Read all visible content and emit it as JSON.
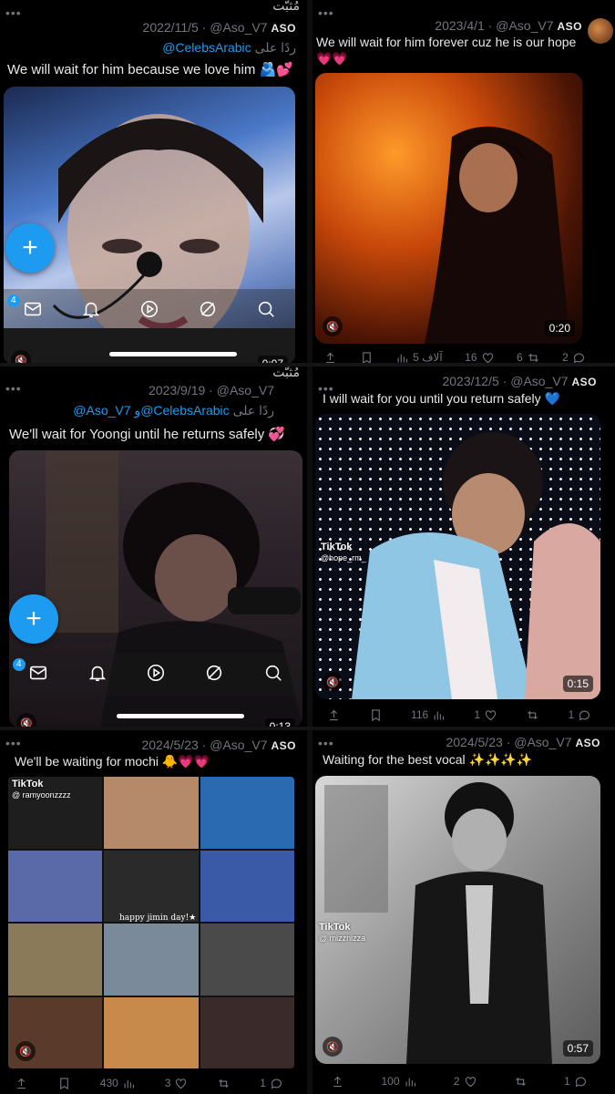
{
  "panels": [
    {
      "id": "p1",
      "pinned_label": "مُثبّت",
      "date": "2022/11/5",
      "handle": "@Aso_V7",
      "name": "ASO",
      "reply_prefix": "ردًا على",
      "reply_mentions": "@CelebsArabic",
      "text": "We will wait for him because we love him 🫂💕",
      "badge_count": "4",
      "duration": "0:07"
    },
    {
      "id": "p2",
      "date": "2023/4/1",
      "handle": "@Aso_V7",
      "name": "ASO",
      "text": "We will wait for him forever cuz he is our hope",
      "emoji": "💗💗",
      "duration": "0:20",
      "views": "5 آلاف",
      "likes": "16",
      "retweets": "6",
      "replies": "2"
    },
    {
      "id": "p3",
      "pinned_label": "مُثبّت",
      "date": "2023/9/19",
      "handle": "@Aso_V7",
      "reply_prefix": "ردًا على",
      "reply_mentions": "@Aso_V7 و@CelebsArabic",
      "text": "We'll wait for Yoongi until he returns safely 💞",
      "badge_count": "4",
      "duration": "0:13"
    },
    {
      "id": "p4",
      "date": "2023/12/5",
      "handle": "@Aso_V7",
      "name": "ASO",
      "text": "I will wait for you until you return safely 💙",
      "watermark": "TikTok",
      "watermark_user": "@hope_rm_",
      "duration": "0:15",
      "views": "116",
      "likes": "1",
      "replies": "1"
    },
    {
      "id": "p5",
      "date": "2024/5/23",
      "handle": "@Aso_V7",
      "name": "ASO",
      "text": "We'll be waiting for mochi 🐥💗💗",
      "watermark": "TikTok",
      "watermark_user": "@ ramyoonzzzz",
      "caption": "happy jimin day!★",
      "views": "430",
      "likes": "3",
      "replies": "1"
    },
    {
      "id": "p6",
      "date": "2024/5/23",
      "handle": "@Aso_V7",
      "name": "ASO",
      "text": "Waiting for the best vocal ✨✨✨✨",
      "watermark": "TikTok",
      "watermark_user": "@ mizznizza",
      "duration": "0:57",
      "views": "100",
      "likes": "2",
      "replies": "1"
    }
  ],
  "colors": {
    "accent": "#1d9bf0",
    "text": "#e7e9ea",
    "muted": "#71767b",
    "background": "#000000"
  }
}
